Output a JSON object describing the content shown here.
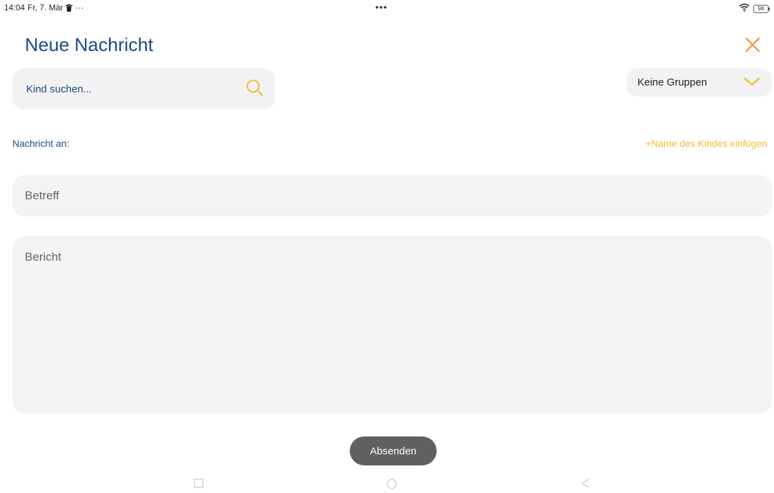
{
  "status_bar": {
    "time": "14:04",
    "date": "Fr, 7. Mär",
    "extra": "···",
    "center_dots": "•••",
    "battery": "98"
  },
  "header": {
    "title": "Neue Nachricht",
    "close_icon": "close-icon"
  },
  "search": {
    "placeholder": "Kind suchen...",
    "value": "",
    "icon": "search-icon"
  },
  "group_filter": {
    "selected": "Keine Gruppen",
    "icon": "chevron-down-icon"
  },
  "recipients": {
    "label": "Nachricht an:",
    "insert_name": "+Name des Kindes einfügen"
  },
  "subject": {
    "placeholder": "Betreff",
    "value": ""
  },
  "message": {
    "placeholder": "Bericht",
    "value": ""
  },
  "send_button": {
    "label": "Absenden"
  },
  "colors": {
    "primary": "#1c4a86",
    "accent": "#f6b731",
    "close": "#f0893a",
    "button": "#606060",
    "field_bg": "#f3f3f3"
  }
}
